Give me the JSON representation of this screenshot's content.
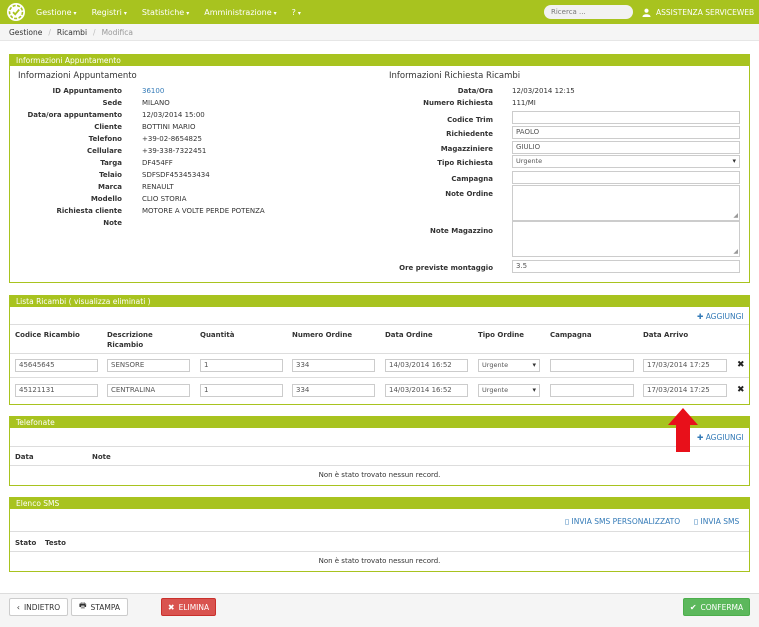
{
  "nav": {
    "items": [
      "Gestione",
      "Registri",
      "Statistiche",
      "Amministrazione",
      "?"
    ],
    "caret": "▾",
    "search_placeholder": "Ricerca ...",
    "user_name": "ASSISTENZA SERVICEWEB"
  },
  "breadcrumb": {
    "items": [
      "Gestione",
      "Ricambi"
    ],
    "active": "Modifica",
    "separator": "/"
  },
  "appointment_panel": {
    "heading": "Informazioni Appuntamento",
    "left_title": "Informazioni Appuntamento",
    "right_title": "Informazioni Richiesta Ricambi",
    "left_fields": [
      {
        "label": "ID Appuntamento",
        "value": "36100"
      },
      {
        "label": "Sede",
        "value": "MILANO"
      },
      {
        "label": "Data/ora appuntamento",
        "value": "12/03/2014 15:00"
      },
      {
        "label": "Cliente",
        "value": "BOTTINI MARIO"
      },
      {
        "label": "Telefono",
        "value": "+39-02-8654825"
      },
      {
        "label": "Cellulare",
        "value": "+39-338-7322451"
      },
      {
        "label": "Targa",
        "value": "DF454FF"
      },
      {
        "label": "Telaio",
        "value": "SDFSDF453453434"
      },
      {
        "label": "Marca",
        "value": "RENAULT"
      },
      {
        "label": "Modello",
        "value": "CLIO STORIA"
      },
      {
        "label": "Richiesta cliente",
        "value": "MOTORE A VOLTE PERDE POTENZA"
      },
      {
        "label": "Note",
        "value": ""
      }
    ],
    "right_static": [
      {
        "label": "Data/Ora",
        "value": "12/03/2014 12:15"
      },
      {
        "label": "Numero Richiesta",
        "value": "111/MI"
      }
    ],
    "right_labels": {
      "codice_trim": "Codice Trim",
      "richiedente": "Richiedente",
      "magazziniere": "Magazziniere",
      "tipo_richiesta": "Tipo Richiesta",
      "campagna": "Campagna",
      "note_ordine": "Note Ordine",
      "note_magazzino": "Note Magazzino",
      "ore_previste": "Ore previste montaggio"
    },
    "right_values": {
      "codice_trim": "",
      "richiedente": "PAOLO",
      "magazziniere": "GIULIO",
      "tipo_richiesta": "Urgente",
      "campagna": "",
      "note_ordine": "",
      "note_magazzino": "",
      "ore_previste": "3.5"
    }
  },
  "ricambi_panel": {
    "heading": "Lista Ricambi ( visualizza eliminati )",
    "add_label": "AGGIUNGI",
    "columns": [
      "Codice Ricambio",
      "Descrizione Ricambio",
      "Quantità",
      "Numero Ordine",
      "Data Ordine",
      "Tipo Ordine",
      "Campagna",
      "Data Arrivo"
    ],
    "rows": [
      {
        "codice": "45645645",
        "descrizione": "SENSORE",
        "quantita": "1",
        "numero_ordine": "334",
        "data_ordine": "14/03/2014 16:52",
        "tipo_ordine": "Urgente",
        "campagna": "",
        "data_arrivo": "17/03/2014 17:25"
      },
      {
        "codice": "45121131",
        "descrizione": "CENTRALINA",
        "quantita": "1",
        "numero_ordine": "334",
        "data_ordine": "14/03/2014 16:52",
        "tipo_ordine": "Urgente",
        "campagna": "",
        "data_arrivo": "17/03/2014 17:25"
      }
    ]
  },
  "telefonate_panel": {
    "heading": "Telefonate",
    "add_label": "AGGIUNGI",
    "columns": [
      "Data",
      "Note"
    ],
    "empty": "Non è stato trovato nessun record."
  },
  "sms_panel": {
    "heading": "Elenco SMS",
    "action_custom": "INVIA SMS PERSONALIZZATO",
    "action_send": "INVIA SMS",
    "columns": [
      "Stato",
      "Testo"
    ],
    "empty": "Non è stato trovato nessun record."
  },
  "footer": {
    "back": "INDIETRO",
    "print": "STAMPA",
    "delete": "ELIMINA",
    "confirm": "CONFERMA"
  },
  "colors": {
    "brand": "#a8c31f",
    "link": "#337ab7",
    "danger": "#d9534f",
    "success": "#5cb85c",
    "annotation_arrow": "#e8101a"
  }
}
